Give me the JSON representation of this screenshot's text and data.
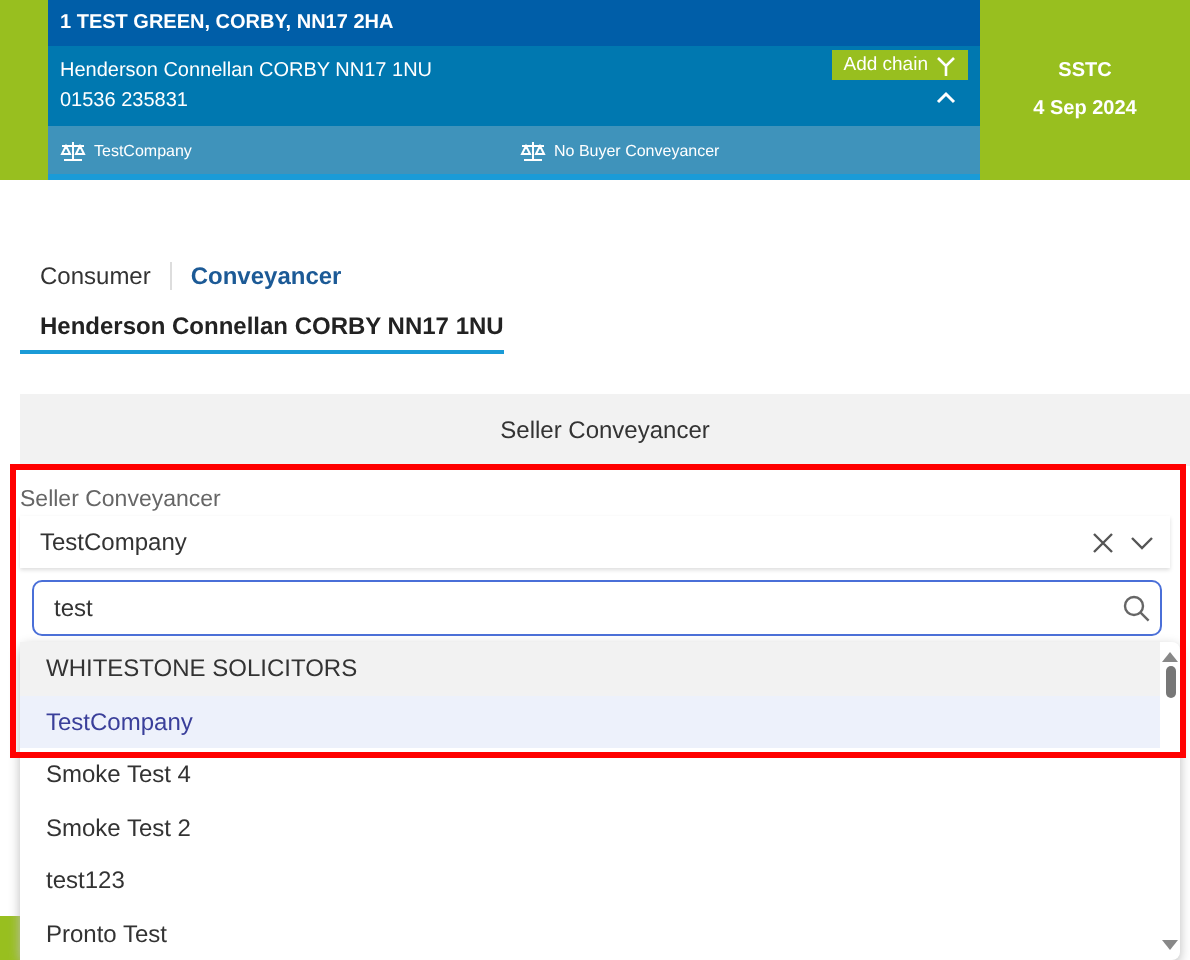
{
  "property_card": {
    "address": "1 TEST GREEN, CORBY, NN17 2HA",
    "agent": "Henderson Connellan CORBY NN17 1NU",
    "phone": "01536 235831",
    "add_chain_button": "Add chain",
    "expanded": true,
    "seller_conveyancer": "TestCompany",
    "buyer_conveyancer": "No Buyer Conveyancer",
    "status": "SSTC",
    "date": "4 Sep 2024"
  },
  "tabs": [
    {
      "label": "Consumer",
      "selected": false
    },
    {
      "label": "Conveyancer",
      "selected": true
    }
  ],
  "branch_tab": {
    "label": "Henderson Connellan CORBY NN17 1NU"
  },
  "section_header": "Seller Conveyancer",
  "seller_field": {
    "label": "Seller Conveyancer",
    "value": "TestCompany"
  },
  "search": {
    "value": "test"
  },
  "options": [
    {
      "label": "WHITESTONE SOLICITORS",
      "selected": false,
      "hovered": true
    },
    {
      "label": "TestCompany",
      "selected": true,
      "hovered": false
    },
    {
      "label": "Smoke Test 4",
      "selected": false,
      "hovered": false
    },
    {
      "label": "Smoke Test 2",
      "selected": false,
      "hovered": false
    },
    {
      "label": "test123",
      "selected": false,
      "hovered": false
    },
    {
      "label": "Pronto Test",
      "selected": false,
      "hovered": false
    }
  ]
}
